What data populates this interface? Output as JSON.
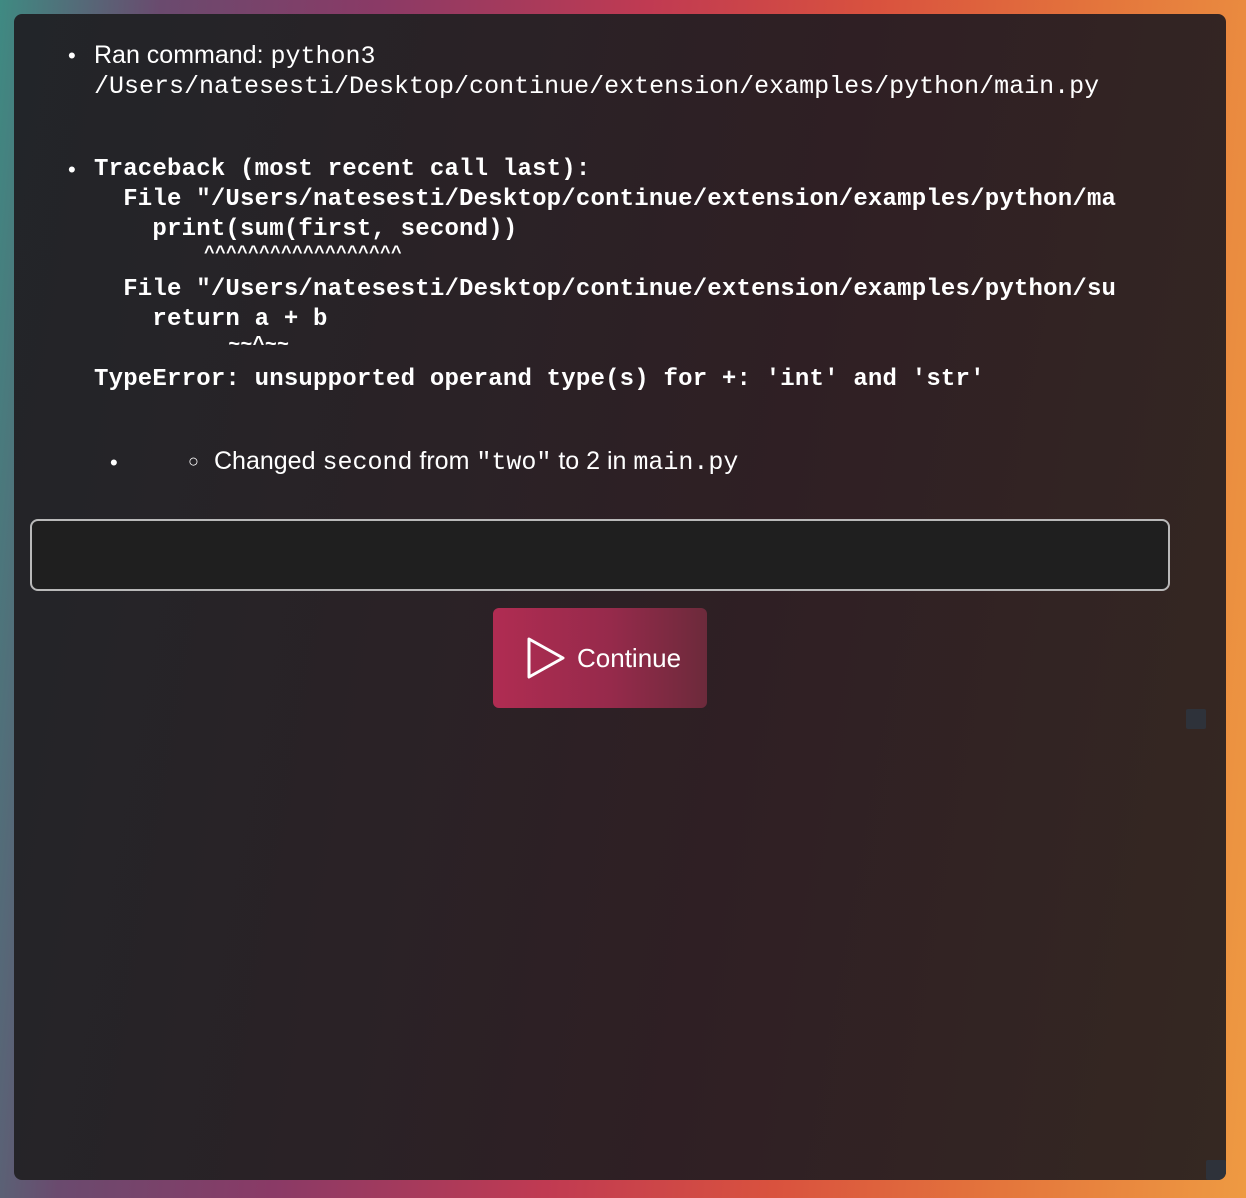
{
  "log": {
    "ran_command": {
      "label": "Ran command: ",
      "command_part1": "python3",
      "command_part2": "/Users/natesesti/Desktop/continue/extension/examples/python/main.py"
    },
    "traceback": [
      "Traceback (most recent call last):",
      "  File \"/Users/natesesti/Desktop/continue/extension/examples/python/ma",
      "    print(sum(first, second))",
      "          ^^^^^^^^^^^^^^^^^^",
      "  File \"/Users/natesesti/Desktop/continue/extension/examples/python/su",
      "    return a + b",
      "           ~~^~~",
      "TypeError: unsupported operand type(s) for +: 'int' and 'str'"
    ],
    "change": {
      "prefix": "Changed ",
      "variable": "second",
      "middle1": " from ",
      "old_value": "\"two\"",
      "middle2": " to 2 in ",
      "file": "main.py"
    }
  },
  "input": {
    "value": "",
    "placeholder": ""
  },
  "continue_button": {
    "label": "Continue",
    "icon": "play-icon"
  },
  "colors": {
    "panel_background": "#2a2226",
    "button_accent": "#b02c52",
    "input_border": "#b9b9b9",
    "text": "#ffffff"
  }
}
